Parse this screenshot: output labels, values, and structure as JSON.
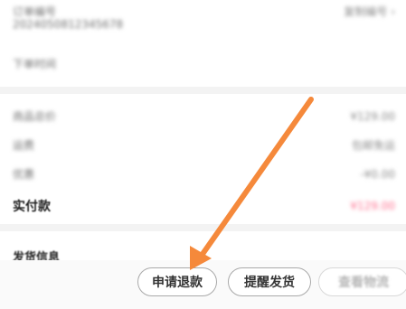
{
  "order_info": {
    "top_title": "订单编号",
    "top_sub": "2024050812345678",
    "top_right": "复制编号 ›",
    "line_2": "下单时间"
  },
  "payment": {
    "rows": [
      {
        "label": "商品总价",
        "value": "¥129.00"
      },
      {
        "label": "运费",
        "value": "包邮免运"
      },
      {
        "label": "优惠",
        "value": "-¥0.00"
      }
    ],
    "actual_label": "实付款",
    "actual_value": "¥129.00"
  },
  "shipping_section_title": "发货信息",
  "actions": {
    "refund_label": "申请退款",
    "remind_label": "提醒发货",
    "view_label": "查看物流"
  },
  "colors": {
    "arrow": "#f5893b",
    "price_accent": "#ff6f8e"
  }
}
